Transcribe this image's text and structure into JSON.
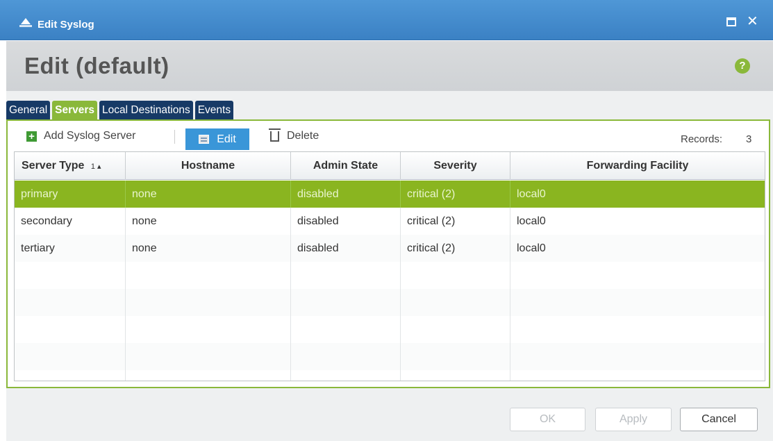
{
  "window": {
    "title": "Edit Syslog",
    "heading": "Edit (default)",
    "help_label": "?"
  },
  "tabs": [
    {
      "label": "General",
      "active": false
    },
    {
      "label": "Servers",
      "active": true
    },
    {
      "label": "Local Destinations",
      "active": false
    },
    {
      "label": "Events",
      "active": false
    }
  ],
  "toolbar": {
    "add_label": "Add Syslog Server",
    "edit_label": "Edit",
    "delete_label": "Delete",
    "records_label": "Records:",
    "records_count": "3"
  },
  "table": {
    "columns": [
      "Server Type",
      "Hostname",
      "Admin State",
      "Severity",
      "Forwarding Facility"
    ],
    "sort_indicator": "1 ▴",
    "rows": [
      {
        "server_type": "primary",
        "hostname": "none",
        "admin_state": "disabled",
        "severity": "critical (2)",
        "forwarding_facility": "local0",
        "selected": true
      },
      {
        "server_type": "secondary",
        "hostname": "none",
        "admin_state": "disabled",
        "severity": "critical (2)",
        "forwarding_facility": "local0",
        "selected": false
      },
      {
        "server_type": "tertiary",
        "hostname": "none",
        "admin_state": "disabled",
        "severity": "critical (2)",
        "forwarding_facility": "local0",
        "selected": false
      }
    ]
  },
  "footer": {
    "ok_label": "OK",
    "apply_label": "Apply",
    "cancel_label": "Cancel"
  },
  "colors": {
    "titlebar": "#3b81c4",
    "tab_active": "#8ab83a",
    "tab_inactive": "#173a66",
    "row_selected": "#8ab520",
    "edit_button": "#3a96d8"
  }
}
